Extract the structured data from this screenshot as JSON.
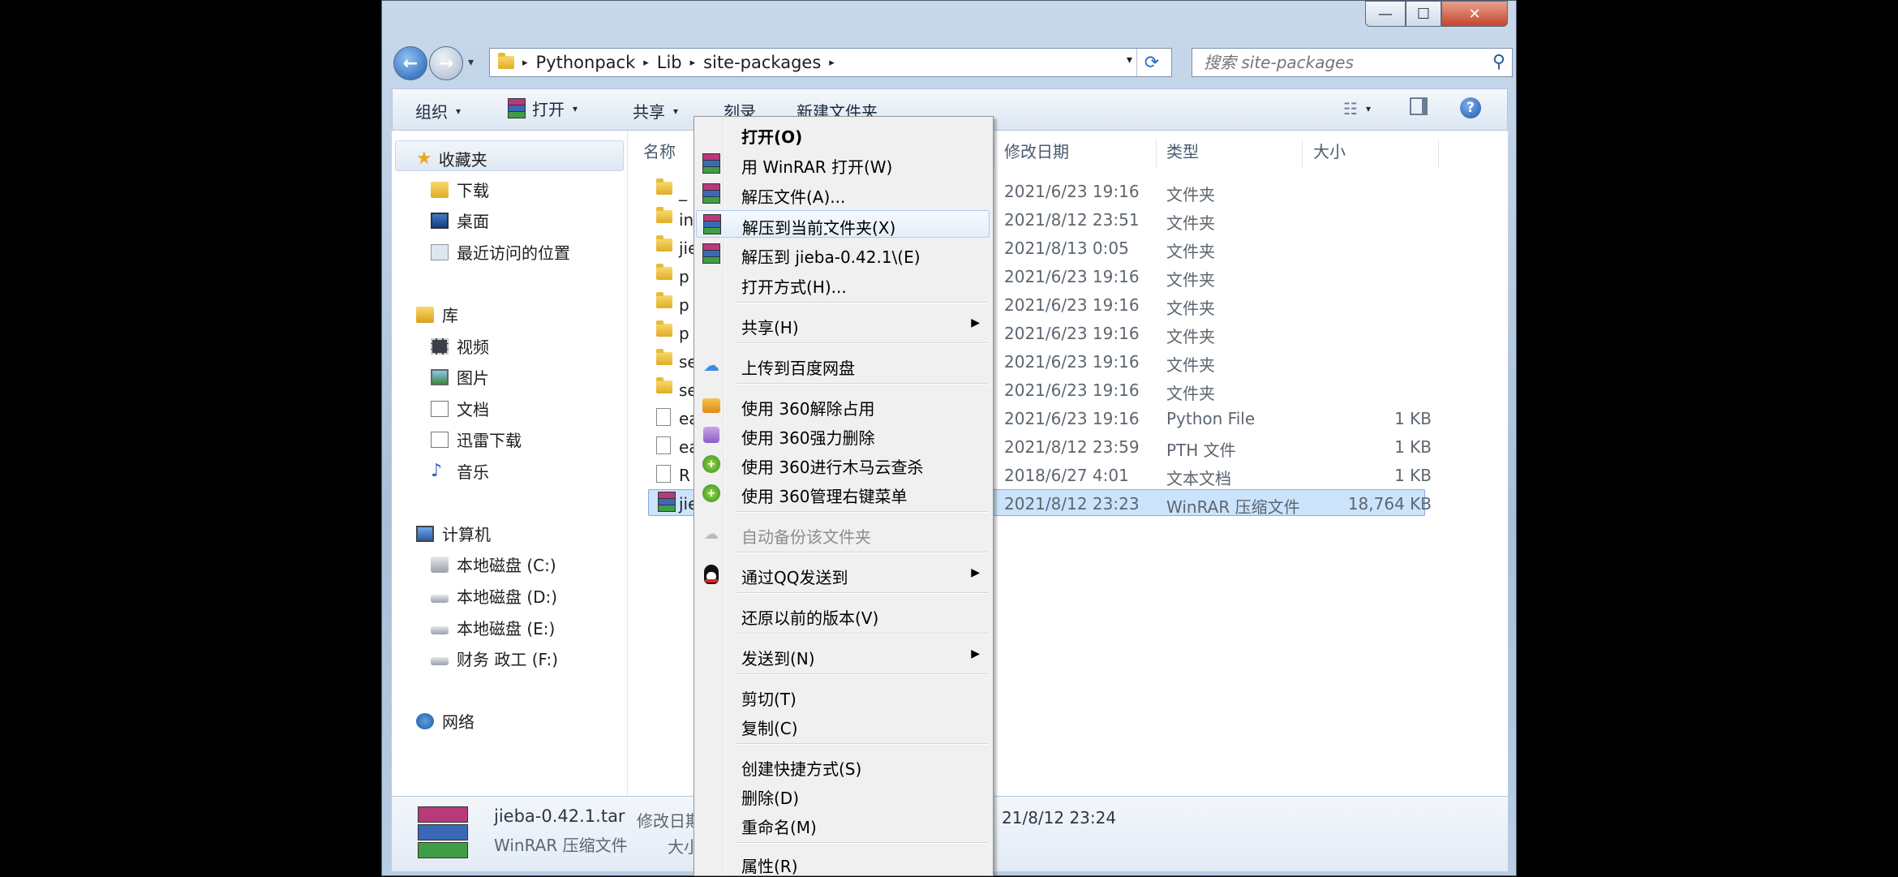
{
  "window": {
    "min_label": "—",
    "max_label": "☐",
    "close_label": "✕"
  },
  "address": {
    "crumbs": [
      "Pythonpack",
      "Lib",
      "site-packages"
    ],
    "separator": "▸",
    "dropdown": "▾",
    "refresh": "⟳"
  },
  "search": {
    "placeholder": "搜索 site-packages"
  },
  "toolbar": {
    "organize": "组织",
    "open": "打开",
    "share": "共享",
    "burn": "刻录",
    "new_folder": "新建文件夹",
    "caret": "▾"
  },
  "nav": {
    "favorites": "收藏夹",
    "downloads": "下载",
    "desktop": "桌面",
    "recent": "最近访问的位置",
    "libraries": "库",
    "videos": "视频",
    "pictures": "图片",
    "documents": "文档",
    "thunder": "迅雷下载",
    "music": "音乐",
    "computer": "计算机",
    "drive_c": "本地磁盘 (C:)",
    "drive_d": "本地磁盘 (D:)",
    "drive_e": "本地磁盘 (E:)",
    "drive_f": "财务 政工 (F:)",
    "network": "网络"
  },
  "columns": {
    "name": "名称",
    "date": "修改日期",
    "type": "类型",
    "size": "大小"
  },
  "files": [
    {
      "name": "_",
      "date": "2021/6/23 19:16",
      "type": "文件夹",
      "size": ""
    },
    {
      "name": "in",
      "date": "2021/8/12 23:51",
      "type": "文件夹",
      "size": ""
    },
    {
      "name": "jie",
      "date": "2021/8/13 0:05",
      "type": "文件夹",
      "size": ""
    },
    {
      "name": "p",
      "date": "2021/6/23 19:16",
      "type": "文件夹",
      "size": ""
    },
    {
      "name": "p",
      "date": "2021/6/23 19:16",
      "type": "文件夹",
      "size": ""
    },
    {
      "name": "p",
      "date": "2021/6/23 19:16",
      "type": "文件夹",
      "size": ""
    },
    {
      "name": "se",
      "date": "2021/6/23 19:16",
      "type": "文件夹",
      "size": ""
    },
    {
      "name": "se",
      "date": "2021/6/23 19:16",
      "type": "文件夹",
      "size": ""
    },
    {
      "name": "ea",
      "date": "2021/6/23 19:16",
      "type": "Python File",
      "size": "1 KB"
    },
    {
      "name": "ea",
      "date": "2021/8/12 23:59",
      "type": "PTH 文件",
      "size": "1 KB"
    },
    {
      "name": "R",
      "date": "2018/6/27 4:01",
      "type": "文本文档",
      "size": "1 KB"
    },
    {
      "name": "jie",
      "date": "2021/8/12 23:23",
      "type": "WinRAR 压缩文件",
      "size": "18,764 KB"
    }
  ],
  "details": {
    "filename": "jieba-0.42.1.tar",
    "modified_label": "修改日期",
    "modified_value": "21/8/12 23:24",
    "type": "WinRAR 压缩文件",
    "size_label": "大小"
  },
  "menu": {
    "open": "打开(O)",
    "open_winrar": "用 WinRAR 打开(W)",
    "extract": "解压文件(A)...",
    "extract_here": "解压到当前文件夹(X)",
    "extract_to": "解压到 jieba-0.42.1\\(E)",
    "open_with": "打开方式(H)...",
    "share": "共享(H)",
    "baidu": "上传到百度网盘",
    "unlock360": "使用 360解除占用",
    "delete360": "使用 360强力删除",
    "scan360": "使用 360进行木马云查杀",
    "menu360": "使用 360管理右键菜单",
    "autobackup": "自动备份该文件夹",
    "qq": "通过QQ发送到",
    "restore": "还原以前的版本(V)",
    "sendto": "发送到(N)",
    "cut": "剪切(T)",
    "copy": "复制(C)",
    "shortcut": "创建快捷方式(S)",
    "delete": "删除(D)",
    "rename": "重命名(M)",
    "properties": "属性(R)",
    "submenu_arrow": "▶"
  }
}
